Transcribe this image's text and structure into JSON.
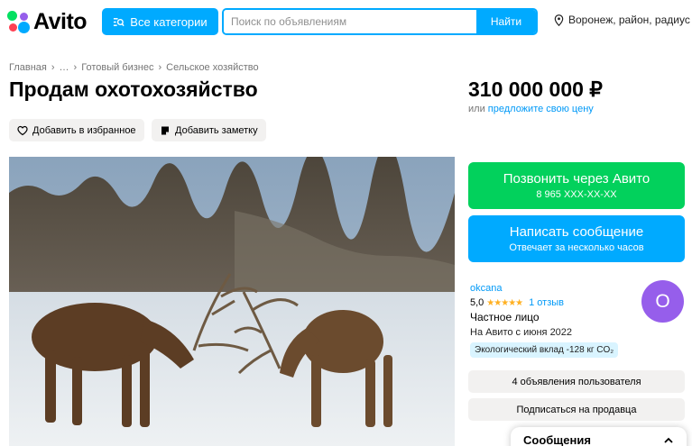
{
  "header": {
    "logo_text": "Avito",
    "categories_label": "Все категории",
    "search_placeholder": "Поиск по объявлениям",
    "search_button": "Найти",
    "location": "Воронеж, район, радиус"
  },
  "breadcrumb": [
    "Главная",
    "…",
    "Готовый бизнес",
    "Сельское хозяйство"
  ],
  "listing": {
    "title": "Продам охотохозяйство",
    "price": "310 000 000 ₽",
    "price_or": "или",
    "price_offer_link": "предложите свою цену",
    "favorite_label": "Добавить в избранное",
    "note_label": "Добавить заметку"
  },
  "contact": {
    "call_label": "Позвонить через Авито",
    "phone": "8 965 XXX-XX-XX",
    "message_label": "Написать сообщение",
    "message_sub": "Отвечает за несколько часов"
  },
  "seller": {
    "name": "okcana",
    "rating": "5,0",
    "stars": "★★★★★",
    "rating_value": 5,
    "reviews": "1 отзыв",
    "type": "Частное лицо",
    "since": "На Авито с июня 2022",
    "eco": "Экологический вклад -128 кг CO₂",
    "avatar_letter": "O",
    "ads_button": "4 объявления пользователя",
    "subscribe_button": "Подписаться на продавца"
  },
  "chat": {
    "title": "Сообщения"
  },
  "colors": {
    "accent": "#00aaff",
    "call_green": "#02d15c",
    "avatar_purple": "#965eeb",
    "link_blue": "#0099f7"
  }
}
